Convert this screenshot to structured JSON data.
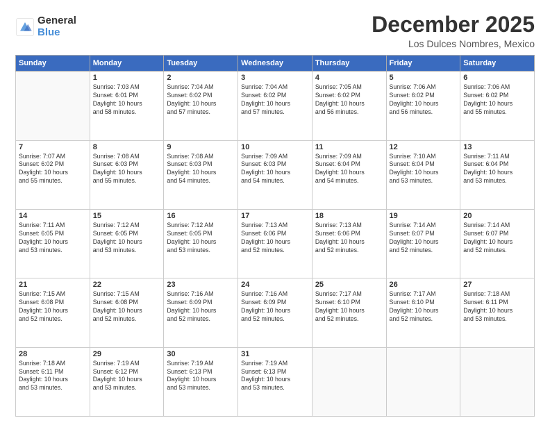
{
  "logo": {
    "general": "General",
    "blue": "Blue"
  },
  "header": {
    "month": "December 2025",
    "location": "Los Dulces Nombres, Mexico"
  },
  "weekdays": [
    "Sunday",
    "Monday",
    "Tuesday",
    "Wednesday",
    "Thursday",
    "Friday",
    "Saturday"
  ],
  "weeks": [
    [
      {
        "day": "",
        "info": ""
      },
      {
        "day": "1",
        "info": "Sunrise: 7:03 AM\nSunset: 6:01 PM\nDaylight: 10 hours\nand 58 minutes."
      },
      {
        "day": "2",
        "info": "Sunrise: 7:04 AM\nSunset: 6:02 PM\nDaylight: 10 hours\nand 57 minutes."
      },
      {
        "day": "3",
        "info": "Sunrise: 7:04 AM\nSunset: 6:02 PM\nDaylight: 10 hours\nand 57 minutes."
      },
      {
        "day": "4",
        "info": "Sunrise: 7:05 AM\nSunset: 6:02 PM\nDaylight: 10 hours\nand 56 minutes."
      },
      {
        "day": "5",
        "info": "Sunrise: 7:06 AM\nSunset: 6:02 PM\nDaylight: 10 hours\nand 56 minutes."
      },
      {
        "day": "6",
        "info": "Sunrise: 7:06 AM\nSunset: 6:02 PM\nDaylight: 10 hours\nand 55 minutes."
      }
    ],
    [
      {
        "day": "7",
        "info": "Sunrise: 7:07 AM\nSunset: 6:02 PM\nDaylight: 10 hours\nand 55 minutes."
      },
      {
        "day": "8",
        "info": "Sunrise: 7:08 AM\nSunset: 6:03 PM\nDaylight: 10 hours\nand 55 minutes."
      },
      {
        "day": "9",
        "info": "Sunrise: 7:08 AM\nSunset: 6:03 PM\nDaylight: 10 hours\nand 54 minutes."
      },
      {
        "day": "10",
        "info": "Sunrise: 7:09 AM\nSunset: 6:03 PM\nDaylight: 10 hours\nand 54 minutes."
      },
      {
        "day": "11",
        "info": "Sunrise: 7:09 AM\nSunset: 6:04 PM\nDaylight: 10 hours\nand 54 minutes."
      },
      {
        "day": "12",
        "info": "Sunrise: 7:10 AM\nSunset: 6:04 PM\nDaylight: 10 hours\nand 53 minutes."
      },
      {
        "day": "13",
        "info": "Sunrise: 7:11 AM\nSunset: 6:04 PM\nDaylight: 10 hours\nand 53 minutes."
      }
    ],
    [
      {
        "day": "14",
        "info": "Sunrise: 7:11 AM\nSunset: 6:05 PM\nDaylight: 10 hours\nand 53 minutes."
      },
      {
        "day": "15",
        "info": "Sunrise: 7:12 AM\nSunset: 6:05 PM\nDaylight: 10 hours\nand 53 minutes."
      },
      {
        "day": "16",
        "info": "Sunrise: 7:12 AM\nSunset: 6:05 PM\nDaylight: 10 hours\nand 53 minutes."
      },
      {
        "day": "17",
        "info": "Sunrise: 7:13 AM\nSunset: 6:06 PM\nDaylight: 10 hours\nand 52 minutes."
      },
      {
        "day": "18",
        "info": "Sunrise: 7:13 AM\nSunset: 6:06 PM\nDaylight: 10 hours\nand 52 minutes."
      },
      {
        "day": "19",
        "info": "Sunrise: 7:14 AM\nSunset: 6:07 PM\nDaylight: 10 hours\nand 52 minutes."
      },
      {
        "day": "20",
        "info": "Sunrise: 7:14 AM\nSunset: 6:07 PM\nDaylight: 10 hours\nand 52 minutes."
      }
    ],
    [
      {
        "day": "21",
        "info": "Sunrise: 7:15 AM\nSunset: 6:08 PM\nDaylight: 10 hours\nand 52 minutes."
      },
      {
        "day": "22",
        "info": "Sunrise: 7:15 AM\nSunset: 6:08 PM\nDaylight: 10 hours\nand 52 minutes."
      },
      {
        "day": "23",
        "info": "Sunrise: 7:16 AM\nSunset: 6:09 PM\nDaylight: 10 hours\nand 52 minutes."
      },
      {
        "day": "24",
        "info": "Sunrise: 7:16 AM\nSunset: 6:09 PM\nDaylight: 10 hours\nand 52 minutes."
      },
      {
        "day": "25",
        "info": "Sunrise: 7:17 AM\nSunset: 6:10 PM\nDaylight: 10 hours\nand 52 minutes."
      },
      {
        "day": "26",
        "info": "Sunrise: 7:17 AM\nSunset: 6:10 PM\nDaylight: 10 hours\nand 52 minutes."
      },
      {
        "day": "27",
        "info": "Sunrise: 7:18 AM\nSunset: 6:11 PM\nDaylight: 10 hours\nand 53 minutes."
      }
    ],
    [
      {
        "day": "28",
        "info": "Sunrise: 7:18 AM\nSunset: 6:11 PM\nDaylight: 10 hours\nand 53 minutes."
      },
      {
        "day": "29",
        "info": "Sunrise: 7:19 AM\nSunset: 6:12 PM\nDaylight: 10 hours\nand 53 minutes."
      },
      {
        "day": "30",
        "info": "Sunrise: 7:19 AM\nSunset: 6:13 PM\nDaylight: 10 hours\nand 53 minutes."
      },
      {
        "day": "31",
        "info": "Sunrise: 7:19 AM\nSunset: 6:13 PM\nDaylight: 10 hours\nand 53 minutes."
      },
      {
        "day": "",
        "info": ""
      },
      {
        "day": "",
        "info": ""
      },
      {
        "day": "",
        "info": ""
      }
    ]
  ]
}
